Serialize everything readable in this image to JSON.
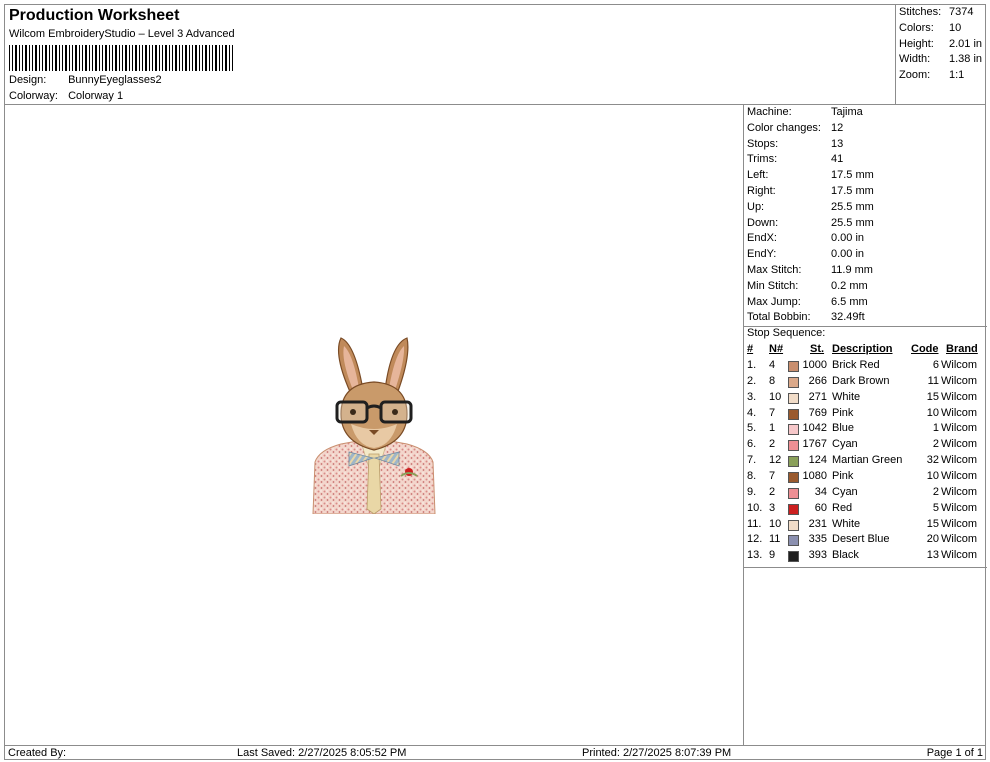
{
  "header": {
    "title": "Production Worksheet",
    "subtitle": "Wilcom EmbroideryStudio – Level 3 Advanced",
    "design_label": "Design:",
    "design_value": "BunnyEyeglasses2",
    "colorway_label": "Colorway:",
    "colorway_value": "Colorway 1"
  },
  "stats": {
    "stitches_label": "Stitches:",
    "stitches_value": "7374",
    "colors_label": "Colors:",
    "colors_value": "10",
    "height_label": "Height:",
    "height_value": "2.01 in",
    "width_label": "Width:",
    "width_value": "1.38 in",
    "zoom_label": "Zoom:",
    "zoom_value": "1:1"
  },
  "machine": {
    "machine_label": "Machine:",
    "machine_value": "Tajima",
    "color_changes_label": "Color changes:",
    "color_changes_value": "12",
    "stops_label": "Stops:",
    "stops_value": "13",
    "trims_label": "Trims:",
    "trims_value": "41",
    "left_label": "Left:",
    "left_value": "17.5 mm",
    "right_label": "Right:",
    "right_value": "17.5 mm",
    "up_label": "Up:",
    "up_value": "25.5 mm",
    "down_label": "Down:",
    "down_value": "25.5 mm",
    "endx_label": "EndX:",
    "endx_value": "0.00 in",
    "endy_label": "EndY:",
    "endy_value": "0.00 in",
    "max_stitch_label": "Max Stitch:",
    "max_stitch_value": "11.9 mm",
    "min_stitch_label": "Min Stitch:",
    "min_stitch_value": "0.2 mm",
    "max_jump_label": "Max Jump:",
    "max_jump_value": "6.5 mm",
    "total_bobbin_label": "Total Bobbin:",
    "total_bobbin_value": "32.49ft"
  },
  "stop_sequence": {
    "title": "Stop Sequence:",
    "headers": {
      "num": "#",
      "nnum": "N#",
      "st": "St.",
      "description": "Description",
      "code": "Code",
      "brand": "Brand"
    },
    "rows": [
      {
        "num": "1.",
        "nnum": "4",
        "color": "#c98f6f",
        "st": "1000",
        "description": "Brick Red",
        "code": "6",
        "brand": "Wilcom"
      },
      {
        "num": "2.",
        "nnum": "8",
        "color": "#dba98a",
        "st": "266",
        "description": "Dark Brown",
        "code": "11",
        "brand": "Wilcom"
      },
      {
        "num": "3.",
        "nnum": "10",
        "color": "#f1dcc8",
        "st": "271",
        "description": "White",
        "code": "15",
        "brand": "Wilcom"
      },
      {
        "num": "4.",
        "nnum": "7",
        "color": "#9a5a2e",
        "st": "769",
        "description": "Pink",
        "code": "10",
        "brand": "Wilcom"
      },
      {
        "num": "5.",
        "nnum": "1",
        "color": "#f6c7c9",
        "st": "1042",
        "description": "Blue",
        "code": "1",
        "brand": "Wilcom"
      },
      {
        "num": "6.",
        "nnum": "2",
        "color": "#ee8f94",
        "st": "1767",
        "description": "Cyan",
        "code": "2",
        "brand": "Wilcom"
      },
      {
        "num": "7.",
        "nnum": "12",
        "color": "#8aa05a",
        "st": "124",
        "description": "Martian Green",
        "code": "32",
        "brand": "Wilcom"
      },
      {
        "num": "8.",
        "nnum": "7",
        "color": "#9a5a2e",
        "st": "1080",
        "description": "Pink",
        "code": "10",
        "brand": "Wilcom"
      },
      {
        "num": "9.",
        "nnum": "2",
        "color": "#ee8f94",
        "st": "34",
        "description": "Cyan",
        "code": "2",
        "brand": "Wilcom"
      },
      {
        "num": "10.",
        "nnum": "3",
        "color": "#cc1f1f",
        "st": "60",
        "description": "Red",
        "code": "5",
        "brand": "Wilcom"
      },
      {
        "num": "11.",
        "nnum": "10",
        "color": "#f1dcc8",
        "st": "231",
        "description": "White",
        "code": "15",
        "brand": "Wilcom"
      },
      {
        "num": "12.",
        "nnum": "11",
        "color": "#8b90b0",
        "st": "335",
        "description": "Desert Blue",
        "code": "20",
        "brand": "Wilcom"
      },
      {
        "num": "13.",
        "nnum": "9",
        "color": "#1f1f1f",
        "st": "393",
        "description": "Black",
        "code": "13",
        "brand": "Wilcom"
      }
    ]
  },
  "footer": {
    "created_by": "Created By:",
    "last_saved": "Last Saved: 2/27/2025 8:05:52 PM",
    "printed": "Printed: 2/27/2025 8:07:39 PM",
    "page": "Page 1 of 1"
  }
}
